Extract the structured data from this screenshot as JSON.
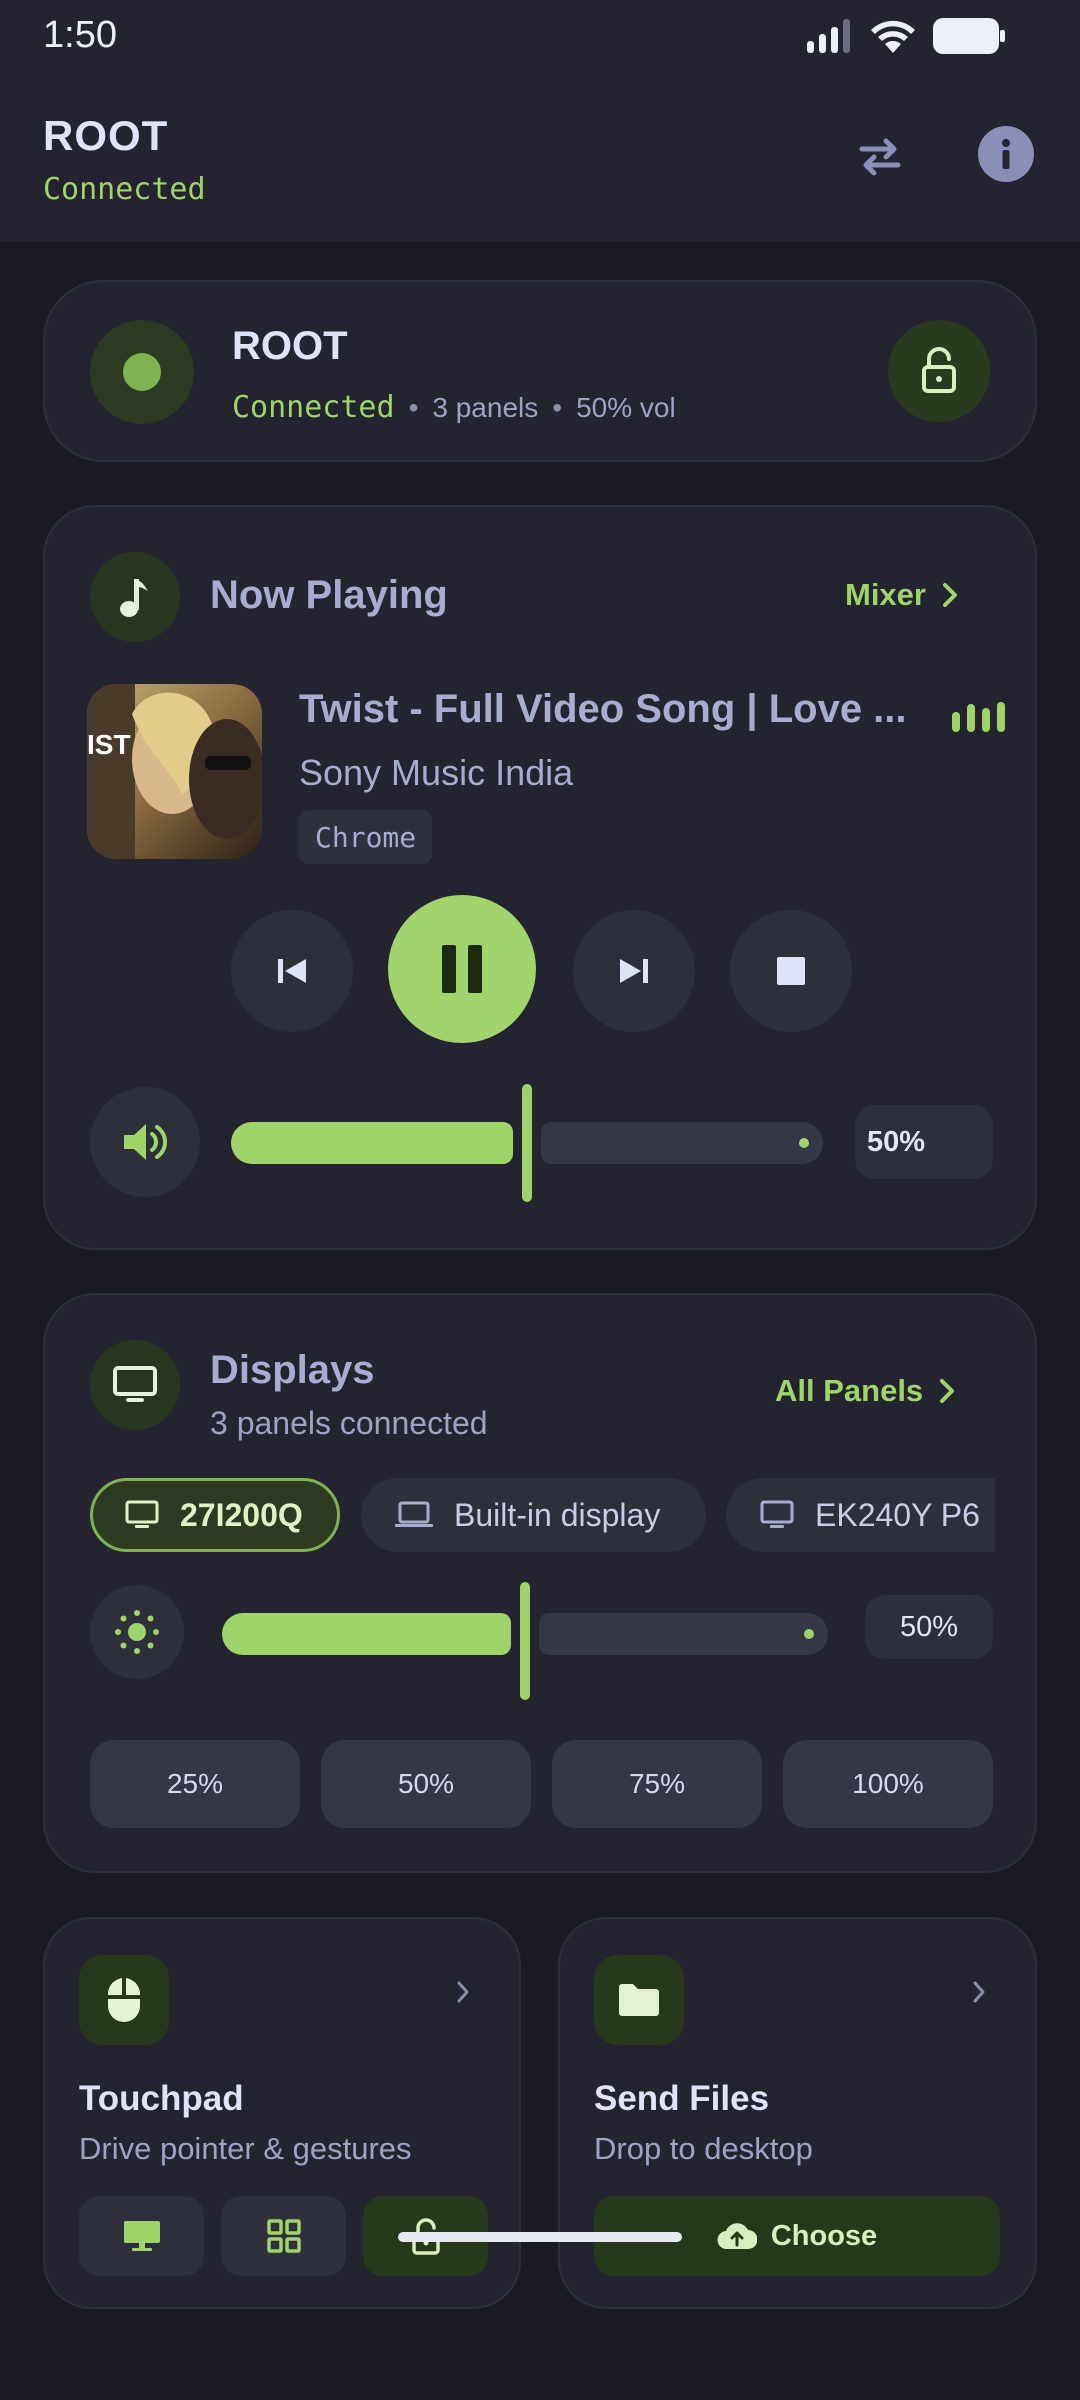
{
  "status_bar": {
    "time": "1:50"
  },
  "app_bar": {
    "title": "ROOT",
    "subtitle": "Connected",
    "swap_icon": "swap-icon",
    "info_icon": "info-icon"
  },
  "connection": {
    "name": "ROOT",
    "status": "Connected",
    "panels": "3 panels",
    "volume": "50% vol",
    "separator": "•"
  },
  "now_playing": {
    "title": "Now Playing",
    "link": "Mixer",
    "track_title": "Twist - Full Video Song | Love ...",
    "artist": "Sony Music India",
    "source": "Chrome",
    "art_text": "IST",
    "volume_percent": 50,
    "volume_label": "50%"
  },
  "displays": {
    "title": "Displays",
    "subtitle": "3 panels connected",
    "link": "All Panels",
    "panels": [
      {
        "label": "27I200Q",
        "active": true,
        "icon": "monitor-icon"
      },
      {
        "label": "Built-in display",
        "active": false,
        "icon": "laptop-icon"
      },
      {
        "label": "EK240Y P6",
        "active": false,
        "icon": "monitor-icon"
      }
    ],
    "brightness_percent": 50,
    "brightness_label": "50%",
    "presets": [
      "25%",
      "50%",
      "75%",
      "100%"
    ]
  },
  "touchpad": {
    "title": "Touchpad",
    "subtitle": "Drive pointer & gestures"
  },
  "send_files": {
    "title": "Send Files",
    "subtitle": "Drop to desktop",
    "button": "Choose"
  },
  "colors": {
    "accent": "#9fd46a",
    "background": "#1a1b24",
    "card": "#23242f"
  }
}
